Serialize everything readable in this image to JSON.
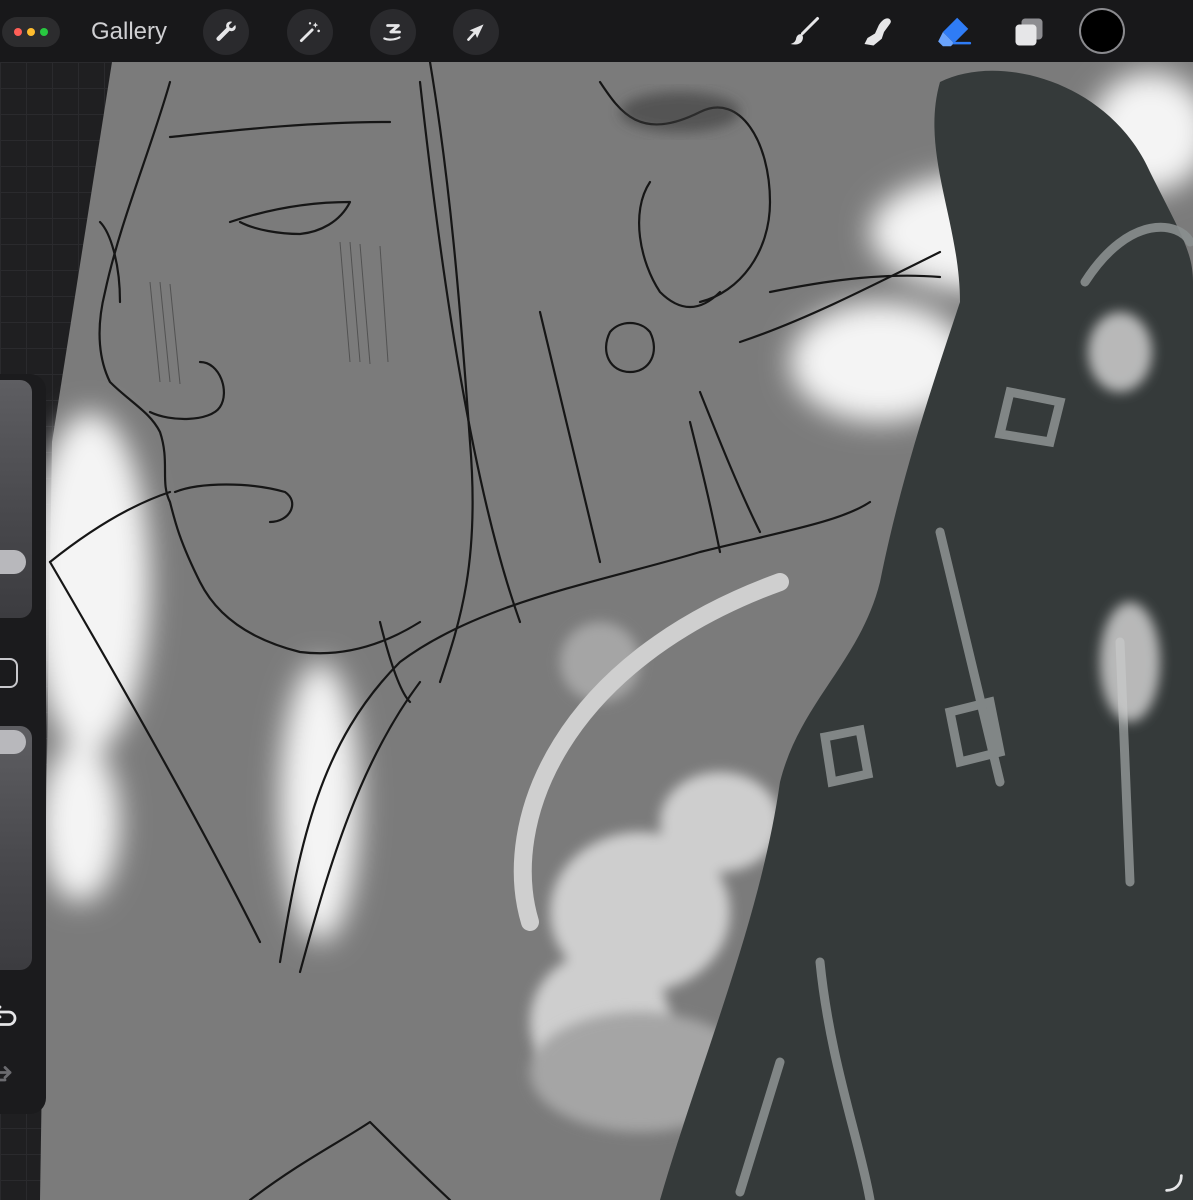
{
  "toolbar": {
    "window_controls_colors": [
      "#ff5f57",
      "#febc2e",
      "#28c840"
    ],
    "gallery_label": "Gallery",
    "left_tools": [
      {
        "name": "actions",
        "icon": "wrench-icon"
      },
      {
        "name": "adjustments",
        "icon": "magic-wand-icon"
      },
      {
        "name": "selection",
        "icon": "selection-s-icon"
      },
      {
        "name": "transform",
        "icon": "arrow-cursor-icon"
      }
    ],
    "right_tools": [
      {
        "name": "brush",
        "icon": "brush-icon",
        "active": false
      },
      {
        "name": "smudge",
        "icon": "smudge-finger-icon",
        "active": false
      },
      {
        "name": "eraser",
        "icon": "eraser-icon",
        "active": true
      },
      {
        "name": "layers",
        "icon": "layers-icon",
        "active": false
      }
    ],
    "active_color": "#000000",
    "accent_color": "#2f7cf6"
  },
  "sidebar": {
    "brush_size_level": 0.2,
    "opacity_level": 0.95,
    "undo_icon": "undo-arrow-icon",
    "redo_icon": "redo-arrow-icon",
    "modify_icon": "square-modify-icon"
  },
  "canvas": {
    "description_icon": "artwork-canvas",
    "corner_icon": "resize-corner-icon"
  }
}
